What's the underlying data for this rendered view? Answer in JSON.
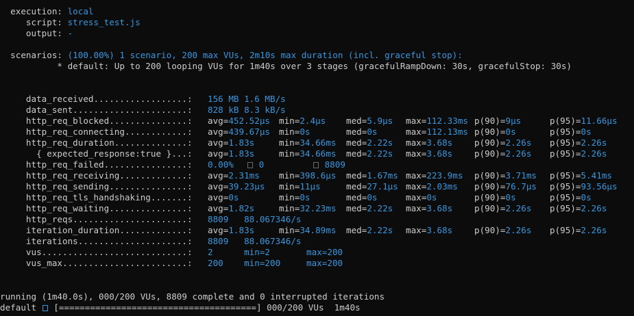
{
  "header": {
    "execution_key": "  execution: ",
    "execution_val": "local",
    "script_key": "     script: ",
    "script_val": "stress_test.js",
    "output_key": "     output: ",
    "output_val": "-"
  },
  "scenarios": {
    "key": "  scenarios: ",
    "val": "(100.00%) 1 scenario, 200 max VUs, 2m10s max duration (incl. graceful stop):",
    "default_line": "           * default: Up to 200 looping VUs for 1m40s over 3 stages (gracefulRampDown: 30s, gracefulStop: 30s)"
  },
  "metrics": [
    {
      "name": "     data_received..................: ",
      "cols": [
        "156 MB 1.6 MB/s"
      ]
    },
    {
      "name": "     data_sent......................: ",
      "cols": [
        "828 kB 8.3 kB/s"
      ]
    },
    {
      "name": "     http_req_blocked...............: ",
      "cols": [
        "avg=452.52µs",
        "min=2.4µs",
        "med=5.9µs",
        "max=112.33ms",
        "p(90)=9µs",
        "p(95)=11.66µs"
      ]
    },
    {
      "name": "     http_req_connecting............: ",
      "cols": [
        "avg=439.67µs",
        "min=0s",
        "med=0s",
        "max=112.13ms",
        "p(90)=0s",
        "p(95)=0s"
      ]
    },
    {
      "name": "     http_req_duration..............: ",
      "cols": [
        "avg=1.83s",
        "min=34.66ms",
        "med=2.22s",
        "max=3.68s",
        "p(90)=2.26s",
        "p(95)=2.26s"
      ]
    },
    {
      "name": "       { expected_response:true }...: ",
      "cols": [
        "avg=1.83s",
        "min=34.66ms",
        "med=2.22s",
        "max=3.68s",
        "p(90)=2.26s",
        "p(95)=2.26s"
      ]
    },
    {
      "name": "     http_req_failed................: ",
      "failed": [
        "0.00%",
        "0",
        "8809"
      ]
    },
    {
      "name": "     http_req_receiving.............: ",
      "cols": [
        "avg=2.31ms",
        "min=398.6µs",
        "med=1.67ms",
        "max=223.9ms",
        "p(90)=3.71ms",
        "p(95)=5.41ms"
      ]
    },
    {
      "name": "     http_req_sending...............: ",
      "cols": [
        "avg=39.23µs",
        "min=11µs",
        "med=27.1µs",
        "max=2.03ms",
        "p(90)=76.7µs",
        "p(95)=93.56µs"
      ]
    },
    {
      "name": "     http_req_tls_handshaking.......: ",
      "cols": [
        "avg=0s",
        "min=0s",
        "med=0s",
        "max=0s",
        "p(90)=0s",
        "p(95)=0s"
      ]
    },
    {
      "name": "     http_req_waiting...............: ",
      "cols": [
        "avg=1.82s",
        "min=32.23ms",
        "med=2.22s",
        "max=3.68s",
        "p(90)=2.26s",
        "p(95)=2.26s"
      ]
    },
    {
      "name": "     http_reqs......................: ",
      "cols": [
        "8809   88.067346/s"
      ]
    },
    {
      "name": "     iteration_duration.............: ",
      "cols": [
        "avg=1.83s",
        "min=34.89ms",
        "med=2.22s",
        "max=3.68s",
        "p(90)=2.26s",
        "p(95)=2.26s"
      ]
    },
    {
      "name": "     iterations.....................: ",
      "cols": [
        "8809   88.067346/s"
      ]
    },
    {
      "name": "     vus............................: ",
      "cols": [
        "2      min=2       max=200"
      ]
    },
    {
      "name": "     vus_max........................: ",
      "cols": [
        "200    min=200     max=200"
      ]
    }
  ],
  "footer": {
    "running": "running (1m40.0s), 000/200 VUs, 8809 complete and 0 interrupted iterations",
    "default_label": "default ",
    "progress_bar": "[======================================]",
    "progress_tail": " 000/200 VUs  1m40s"
  }
}
